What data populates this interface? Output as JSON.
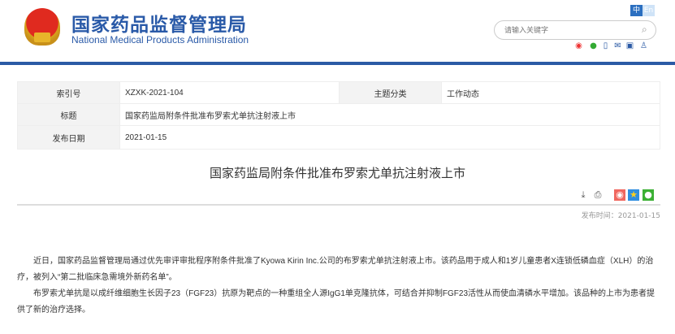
{
  "header": {
    "logo_cn": "国家药品监督管理局",
    "logo_en": "National Medical Products Administration",
    "lang_cn": "中",
    "lang_en": "En",
    "search_placeholder": "请输入关键字"
  },
  "meta": {
    "index_label": "索引号",
    "index_value": "XZXK-2021-104",
    "topic_label": "主题分类",
    "topic_value": "工作动态",
    "title_label": "标题",
    "title_value": "国家药监局附条件批准布罗索尤单抗注射液上市",
    "date_label": "发布日期",
    "date_value": "2021-01-15"
  },
  "article": {
    "title": "国家药监局附条件批准布罗索尤单抗注射液上市",
    "pub_time": "发布时间：2021-01-15",
    "paragraphs": [
      "近日，国家药品监督管理局通过优先审评审批程序附条件批准了Kyowa Kirin Inc.公司的布罗索尤单抗注射液上市。该药品用于成人和1岁儿童患者X连锁低磷血症（XLH）的治疗，被列入“第二批临床急需境外新药名单”。",
      "布罗索尤单抗是以成纤维细胞生长因子23（FGF23）抗原为靶点的一种重组全人源IgG1单克隆抗体，可结合并抑制FGF23活性从而使血清磷水平增加。该品种的上市为患者提供了新的治疗选择。"
    ]
  },
  "colors": {
    "brand": "#2b5aa5"
  }
}
